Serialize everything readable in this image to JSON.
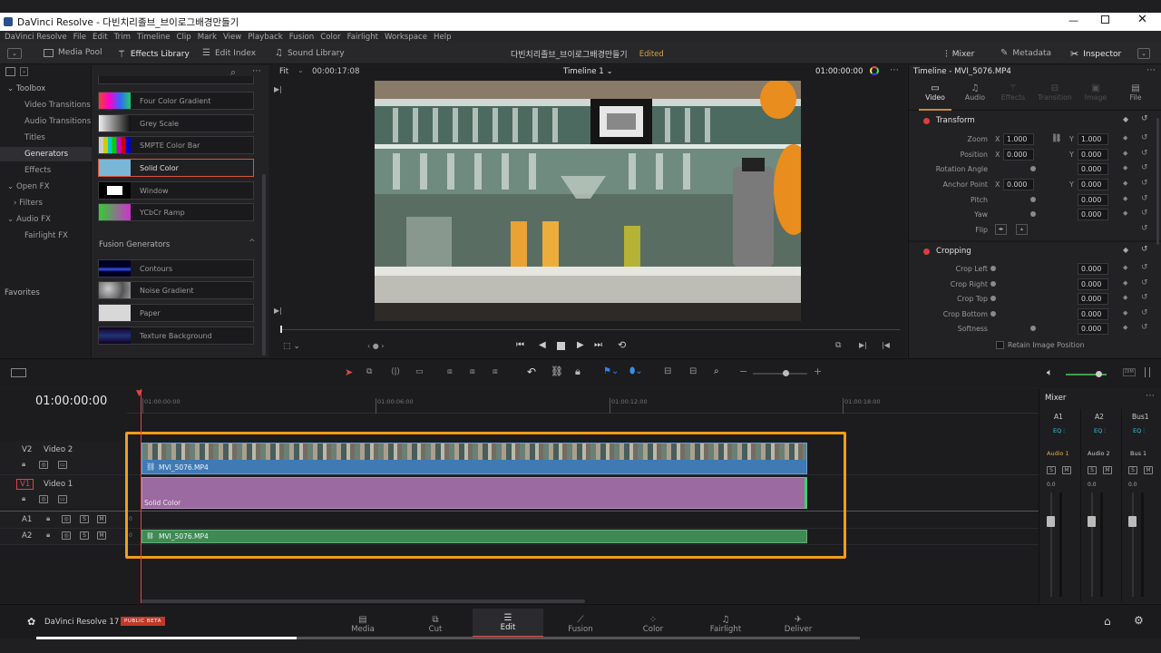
{
  "window": {
    "title": "DaVinci Resolve - 다빈치리졸브_브이로그배경만들기"
  },
  "menu": [
    "DaVinci Resolve",
    "File",
    "Edit",
    "Trim",
    "Timeline",
    "Clip",
    "Mark",
    "View",
    "Playback",
    "Fusion",
    "Color",
    "Fairlight",
    "Workspace",
    "Help"
  ],
  "toolbar": {
    "media_pool": "Media Pool",
    "effects_library": "Effects Library",
    "edit_index": "Edit Index",
    "sound_library": "Sound Library",
    "project_name": "다빈치리졸브_브이로그배경만들기",
    "edited": "Edited",
    "mixer": "Mixer",
    "metadata": "Metadata",
    "inspector": "Inspector"
  },
  "library": {
    "toolbox": "Toolbox",
    "tree": [
      "Video Transitions",
      "Audio Transitions",
      "Titles",
      "Generators",
      "Effects"
    ],
    "open_fx": "Open FX",
    "filters": "Filters",
    "audio_fx": "Audio FX",
    "fairlight_fx": "Fairlight FX",
    "favorites": "Favorites",
    "generators": [
      "Four Color Gradient",
      "Grey Scale",
      "SMPTE Color Bar",
      "Solid Color",
      "Window",
      "YCbCr Ramp"
    ],
    "fusion_header": "Fusion Generators",
    "fusion_generators": [
      "Contours",
      "Noise Gradient",
      "Paper",
      "Texture Background"
    ]
  },
  "viewer": {
    "fit": "Fit",
    "source_tc": "00:00:17:08",
    "timeline_name": "Timeline 1",
    "timecode": "01:00:00:00"
  },
  "inspector": {
    "header": "Timeline - MVI_5076.MP4",
    "tabs": [
      "Video",
      "Audio",
      "Effects",
      "Transition",
      "Image",
      "File"
    ],
    "transform": "Transform",
    "zoom_label": "Zoom",
    "zoom_x": "1.000",
    "zoom_y": "1.000",
    "position_label": "Position",
    "pos_x": "0.000",
    "pos_y": "0.000",
    "rotation_label": "Rotation Angle",
    "rotation": "0.000",
    "anchor_label": "Anchor Point",
    "anchor_x": "0.000",
    "anchor_y": "0.000",
    "pitch_label": "Pitch",
    "pitch": "0.000",
    "yaw_label": "Yaw",
    "yaw": "0.000",
    "flip_label": "Flip",
    "cropping": "Cropping",
    "crop_left_label": "Crop Left",
    "crop_left": "0.000",
    "crop_right_label": "Crop Right",
    "crop_right": "0.000",
    "crop_top_label": "Crop Top",
    "crop_top": "0.000",
    "crop_bottom_label": "Crop Bottom",
    "crop_bottom": "0.000",
    "softness_label": "Softness",
    "softness": "0.000",
    "retain": "Retain Image Position",
    "axis_x": "X",
    "axis_y": "Y"
  },
  "timeline": {
    "timecode": "01:00:00:00",
    "ruler": [
      "01:00:00:00",
      "01:00:06:00",
      "01:00:12:00",
      "01:00:18:00"
    ],
    "v2_id": "V2",
    "v2_name": "Video 2",
    "v1_id": "V1",
    "v1_name": "Video 1",
    "a1_id": "A1",
    "a2_id": "A2",
    "solo": "S",
    "mute": "M",
    "zero": "0",
    "clip_v2": "MVI_5076.MP4",
    "clip_v1": "Solid Color",
    "clip_a2": "MVI_5076.MP4"
  },
  "mixer": {
    "title": "Mixer",
    "channels": [
      "A1",
      "A2",
      "Bus1"
    ],
    "eq": "EQ",
    "names": [
      "Audio 1",
      "Audio 2",
      "Bus 1"
    ],
    "level": "0.0",
    "solo": "S",
    "mute": "M"
  },
  "pages": [
    "Media",
    "Cut",
    "Edit",
    "Fusion",
    "Color",
    "Fairlight",
    "Deliver"
  ],
  "brand": {
    "name": "DaVinci Resolve 17",
    "beta": "PUBLIC BETA"
  },
  "colors": {
    "accent": "#e2891e",
    "clip_blue": "#3f7ab5",
    "clip_purple": "#9b6aa0",
    "clip_green": "#3f8a54",
    "playhead": "#e54444",
    "highlight_red": "#d44"
  }
}
